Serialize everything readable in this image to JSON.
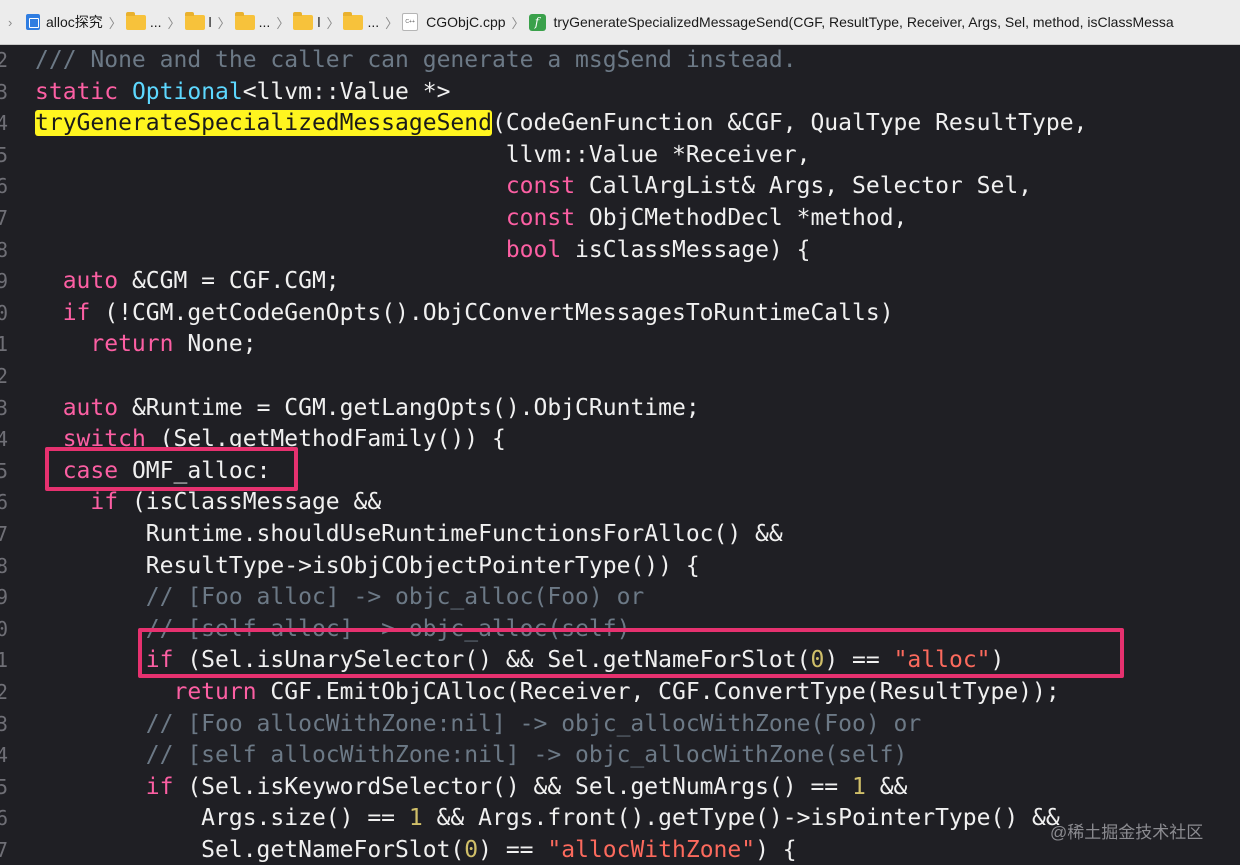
{
  "jumpbar": {
    "nav_glyph": "›",
    "project": "alloc探究",
    "folders": [
      "...",
      "l",
      "...",
      "l",
      "..."
    ],
    "file": "CGObjC.cpp",
    "file_badge": "C++",
    "function_glyph": "f",
    "function": "tryGenerateSpecializedMessageSend(CGF, ResultType, Receiver, Args, Sel, method, isClassMessa"
  },
  "editor": {
    "lines": [
      {
        "n": "2",
        "segs": [
          {
            "t": "/// None and the caller can generate a msgSend instead.",
            "c": "cm"
          }
        ]
      },
      {
        "n": "3",
        "segs": [
          {
            "t": "static",
            "c": "kw"
          },
          {
            "t": " "
          },
          {
            "t": "Optional",
            "c": "ty"
          },
          {
            "t": "<llvm::Value *>"
          }
        ]
      },
      {
        "n": "4",
        "segs": [
          {
            "t": "tryGenerateSpecializedMessageSend",
            "c": "hl"
          },
          {
            "t": "(CodeGenFunction &CGF, QualType ResultType,"
          }
        ]
      },
      {
        "n": "5",
        "segs": [
          {
            "t": "                                  llvm::Value *Receiver,"
          }
        ]
      },
      {
        "n": "6",
        "segs": [
          {
            "t": "                                  "
          },
          {
            "t": "const",
            "c": "kw"
          },
          {
            "t": " CallArgList& Args, Selector Sel,"
          }
        ]
      },
      {
        "n": "7",
        "segs": [
          {
            "t": "                                  "
          },
          {
            "t": "const",
            "c": "kw"
          },
          {
            "t": " ObjCMethodDecl *method,"
          }
        ]
      },
      {
        "n": "8",
        "segs": [
          {
            "t": "                                  "
          },
          {
            "t": "bool",
            "c": "kw"
          },
          {
            "t": " isClassMessage) {"
          }
        ]
      },
      {
        "n": "9",
        "segs": [
          {
            "t": "  "
          },
          {
            "t": "auto",
            "c": "kw"
          },
          {
            "t": " &CGM = CGF.CGM;"
          }
        ]
      },
      {
        "n": "0",
        "segs": [
          {
            "t": "  "
          },
          {
            "t": "if",
            "c": "kw"
          },
          {
            "t": " (!CGM.getCodeGenOpts().ObjCConvertMessagesToRuntimeCalls)"
          }
        ]
      },
      {
        "n": "1",
        "segs": [
          {
            "t": "    "
          },
          {
            "t": "return",
            "c": "kw"
          },
          {
            "t": " None;"
          }
        ]
      },
      {
        "n": "2",
        "segs": [
          {
            "t": ""
          }
        ]
      },
      {
        "n": "3",
        "segs": [
          {
            "t": "  "
          },
          {
            "t": "auto",
            "c": "kw"
          },
          {
            "t": " &Runtime = CGM.getLangOpts().ObjCRuntime;"
          }
        ]
      },
      {
        "n": "4",
        "segs": [
          {
            "t": "  "
          },
          {
            "t": "switch",
            "c": "kw"
          },
          {
            "t": " (Sel.getMethodFamily()) {"
          }
        ]
      },
      {
        "n": "5",
        "segs": [
          {
            "t": "  "
          },
          {
            "t": "case",
            "c": "kw"
          },
          {
            "t": " OMF_alloc:"
          }
        ]
      },
      {
        "n": "6",
        "segs": [
          {
            "t": "    "
          },
          {
            "t": "if",
            "c": "kw"
          },
          {
            "t": " (isClassMessage &&"
          }
        ]
      },
      {
        "n": "7",
        "segs": [
          {
            "t": "        Runtime.shouldUseRuntimeFunctionsForAlloc() &&"
          }
        ]
      },
      {
        "n": "8",
        "segs": [
          {
            "t": "        ResultType->isObjCObjectPointerType()) {"
          }
        ]
      },
      {
        "n": "9",
        "segs": [
          {
            "t": "        "
          },
          {
            "t": "// [Foo alloc] -> objc_alloc(Foo) or",
            "c": "cm"
          }
        ]
      },
      {
        "n": "0",
        "segs": [
          {
            "t": "        "
          },
          {
            "t": "// [self alloc] -> objc_alloc(self)",
            "c": "cm"
          }
        ]
      },
      {
        "n": "1",
        "segs": [
          {
            "t": "        "
          },
          {
            "t": "if",
            "c": "kw"
          },
          {
            "t": " (Sel.isUnarySelector() && Sel.getNameForSlot("
          },
          {
            "t": "0",
            "c": "nu"
          },
          {
            "t": ") == "
          },
          {
            "t": "\"alloc\"",
            "c": "st"
          },
          {
            "t": ")"
          }
        ]
      },
      {
        "n": "2",
        "segs": [
          {
            "t": "          "
          },
          {
            "t": "return",
            "c": "kw"
          },
          {
            "t": " CGF.EmitObjCAlloc(Receiver, CGF.ConvertType(ResultType));"
          }
        ]
      },
      {
        "n": "3",
        "segs": [
          {
            "t": "        "
          },
          {
            "t": "// [Foo allocWithZone:nil] -> objc_allocWithZone(Foo) or",
            "c": "cm"
          }
        ]
      },
      {
        "n": "4",
        "segs": [
          {
            "t": "        "
          },
          {
            "t": "// [self allocWithZone:nil] -> objc_allocWithZone(self)",
            "c": "cm"
          }
        ]
      },
      {
        "n": "5",
        "segs": [
          {
            "t": "        "
          },
          {
            "t": "if",
            "c": "kw"
          },
          {
            "t": " (Sel.isKeywordSelector() && Sel.getNumArgs() == "
          },
          {
            "t": "1",
            "c": "nu"
          },
          {
            "t": " &&"
          }
        ]
      },
      {
        "n": "6",
        "segs": [
          {
            "t": "            Args.size() == "
          },
          {
            "t": "1",
            "c": "nu"
          },
          {
            "t": " && Args.front().getType()->isPointerType() &&"
          }
        ]
      },
      {
        "n": "7",
        "segs": [
          {
            "t": "            Sel.getNameForSlot("
          },
          {
            "t": "0",
            "c": "nu"
          },
          {
            "t": ") == "
          },
          {
            "t": "\"allocWithZone\"",
            "c": "st"
          },
          {
            "t": ") {"
          }
        ]
      }
    ]
  },
  "watermark": "@稀土掘金技术社区"
}
